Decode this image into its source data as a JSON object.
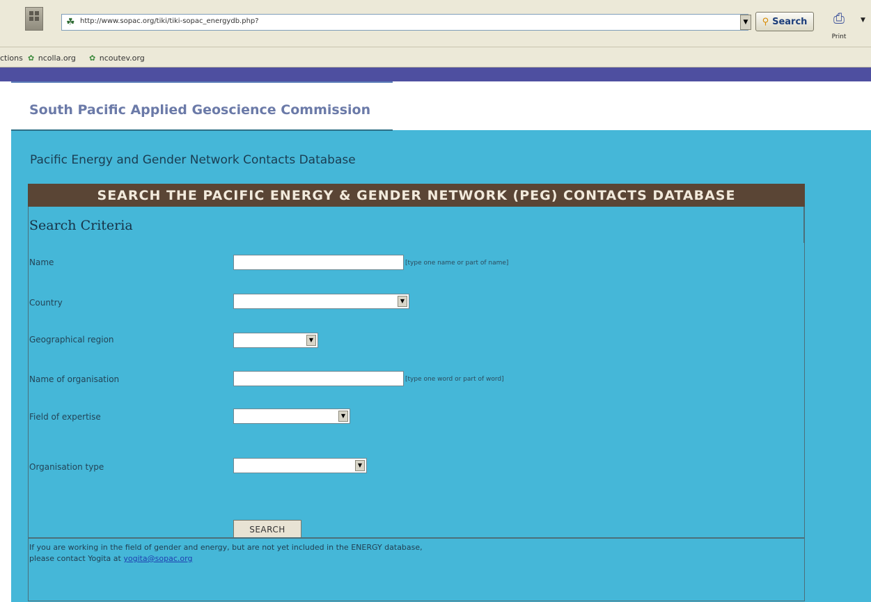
{
  "browser": {
    "address": "http://www.sopac.org/tiki/tiki-sopac_energydb.php?",
    "search_label": "Search",
    "print_label": "Print",
    "links": [
      {
        "label": "ctions"
      },
      {
        "label": "ncolla.org"
      },
      {
        "label": "ncoutev.org"
      }
    ],
    "icons": {
      "page": "globe-icon",
      "search": "search-icon",
      "print": "printer-icon",
      "link": "link-leaf-icon"
    }
  },
  "site": {
    "org_title": "South Pacific Applied Geoscience Commission",
    "db_subtitle": "Pacific Energy and Gender Network Contacts Database"
  },
  "form": {
    "banner": "SEARCH THE PACIFIC ENERGY & GENDER NETWORK (PEG) CONTACTS DATABASE",
    "criteria_heading": "Search Criteria",
    "fields": {
      "name": {
        "label": "Name",
        "value": "",
        "hint": "[type one name or part of name]"
      },
      "country": {
        "label": "Country",
        "selected": ""
      },
      "region": {
        "label": "Geographical region",
        "selected": ""
      },
      "organisation_name": {
        "label": "Name of organisation",
        "value": "",
        "hint": "[type one word or part of word]"
      },
      "expertise": {
        "label": "Field of expertise",
        "selected": ""
      },
      "organisation_type": {
        "label": "Organisation type",
        "selected": ""
      }
    },
    "submit_label": "SEARCH"
  },
  "footer": {
    "line1": "If you are working in the field of gender and energy, but are not yet included in the ENERGY database,",
    "line2_prefix": "please contact Yogita at ",
    "contact_email": "yogita@sopac.org"
  },
  "colors": {
    "page_background": "#45b7d8",
    "banner": "#5a4535",
    "nav_band": "#4e4fa0",
    "title_text": "#6b7aa8"
  }
}
